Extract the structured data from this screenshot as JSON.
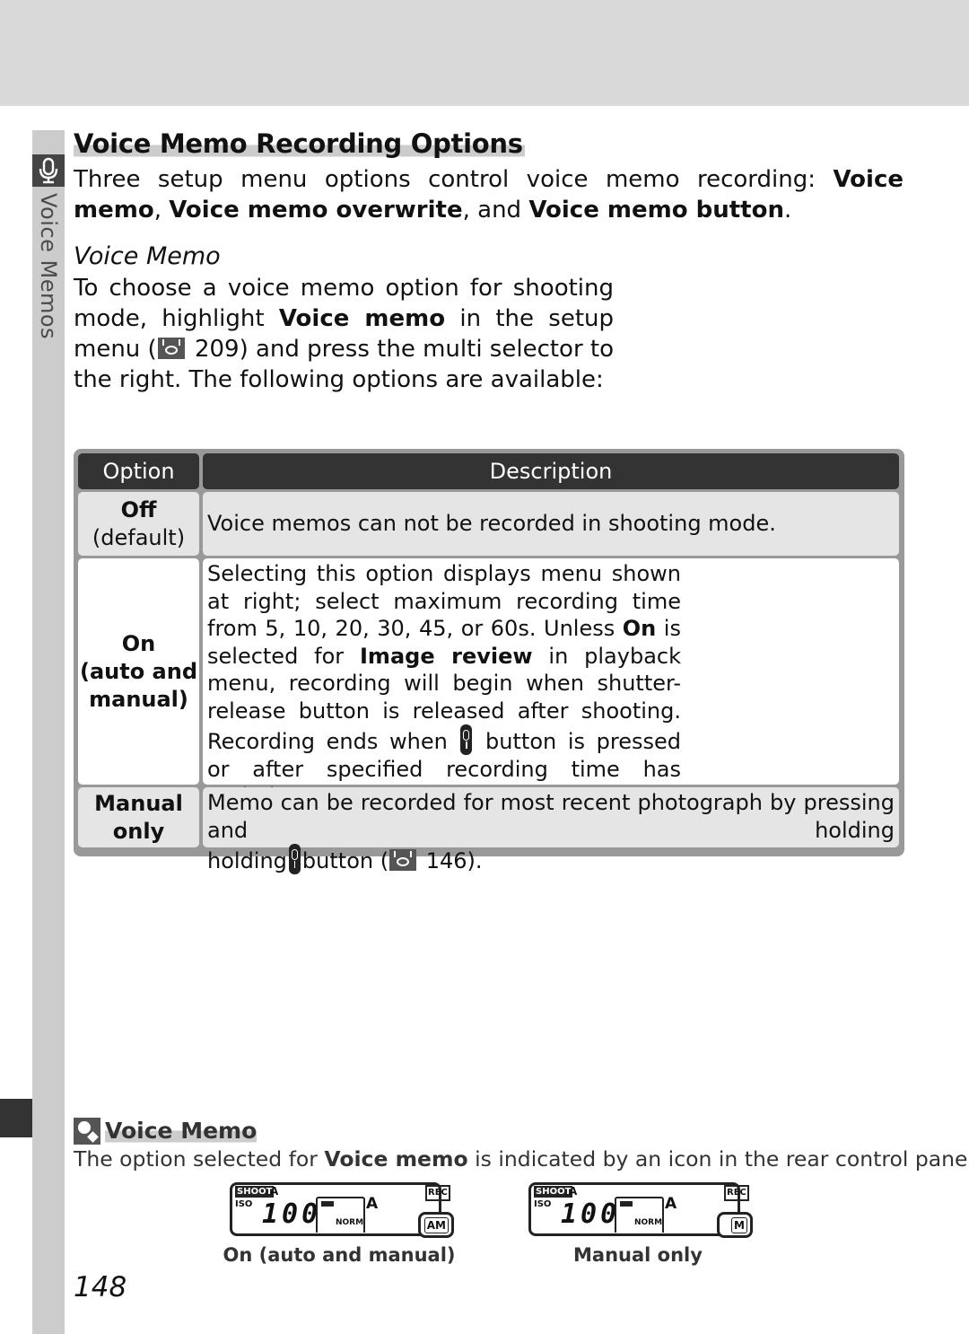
{
  "sidebar": {
    "section_label": "Voice Memos",
    "section_icon": "microphone-icon"
  },
  "title": "Voice Memo Recording Options",
  "intro": {
    "t1": "Three setup menu options control voice memo recording: ",
    "b1": "Voice memo",
    "t2": ", ",
    "b2": "Voice memo overwrite",
    "t3": ", and ",
    "b3": "Voice memo button",
    "t4": "."
  },
  "subsection": {
    "title": "Voice Memo",
    "t1": "To choose a voice memo option for shooting mode, highlight ",
    "b1": "Voice memo",
    "t2": " in the setup menu (",
    "page_ref_icon": "page-reference-icon",
    "t3": " 209) and press the multi selector to the right. The following options are available:"
  },
  "table": {
    "headers": [
      "Option",
      "Description"
    ],
    "rows": [
      {
        "option": "Off",
        "option_sub": "(default)",
        "description": "Voice memos can not be recorded in shooting mode."
      },
      {
        "option_lines": [
          "On",
          "(auto and",
          "manual)"
        ],
        "d1": "Selecting this option displays menu shown at right; select maximum recording time from 5, 10, 20, 30, 45, or 60s. Unless ",
        "db1": "On",
        "d2": " is selected for ",
        "db2": "Image review",
        "d3": " in playback menu, recording will begin when shutter-release button is released after shooting. Recording ends when ",
        "d4": " button is pressed or after specified recording time has ",
        "d5": "ended."
      },
      {
        "option_lines": [
          "Manual",
          "only"
        ],
        "d1": "Memo can be recorded for most recent photograph by pressing and holding",
        "d2": "button (",
        "d3": " 146)."
      }
    ]
  },
  "note": {
    "icon": "tip-icon",
    "title": "Voice Memo",
    "t1": "The option selected for ",
    "b1": "Voice memo",
    "t2": " is indicated by an icon in the rear control panel."
  },
  "panels": [
    {
      "caption": "On (auto and manual)",
      "shoot": "SHOOT",
      "shoot_mode": "A",
      "iso_label": "ISO",
      "iso_value": "100",
      "quality": "NORM",
      "af": "A",
      "rec": "REC",
      "mode_icon": "AM"
    },
    {
      "caption": "Manual only",
      "shoot": "SHOOT",
      "shoot_mode": "A",
      "iso_label": "ISO",
      "iso_value": "100",
      "quality": "NORM",
      "af": "A",
      "rec": "REC",
      "mode_icon": "M"
    }
  ],
  "page_number": "148"
}
